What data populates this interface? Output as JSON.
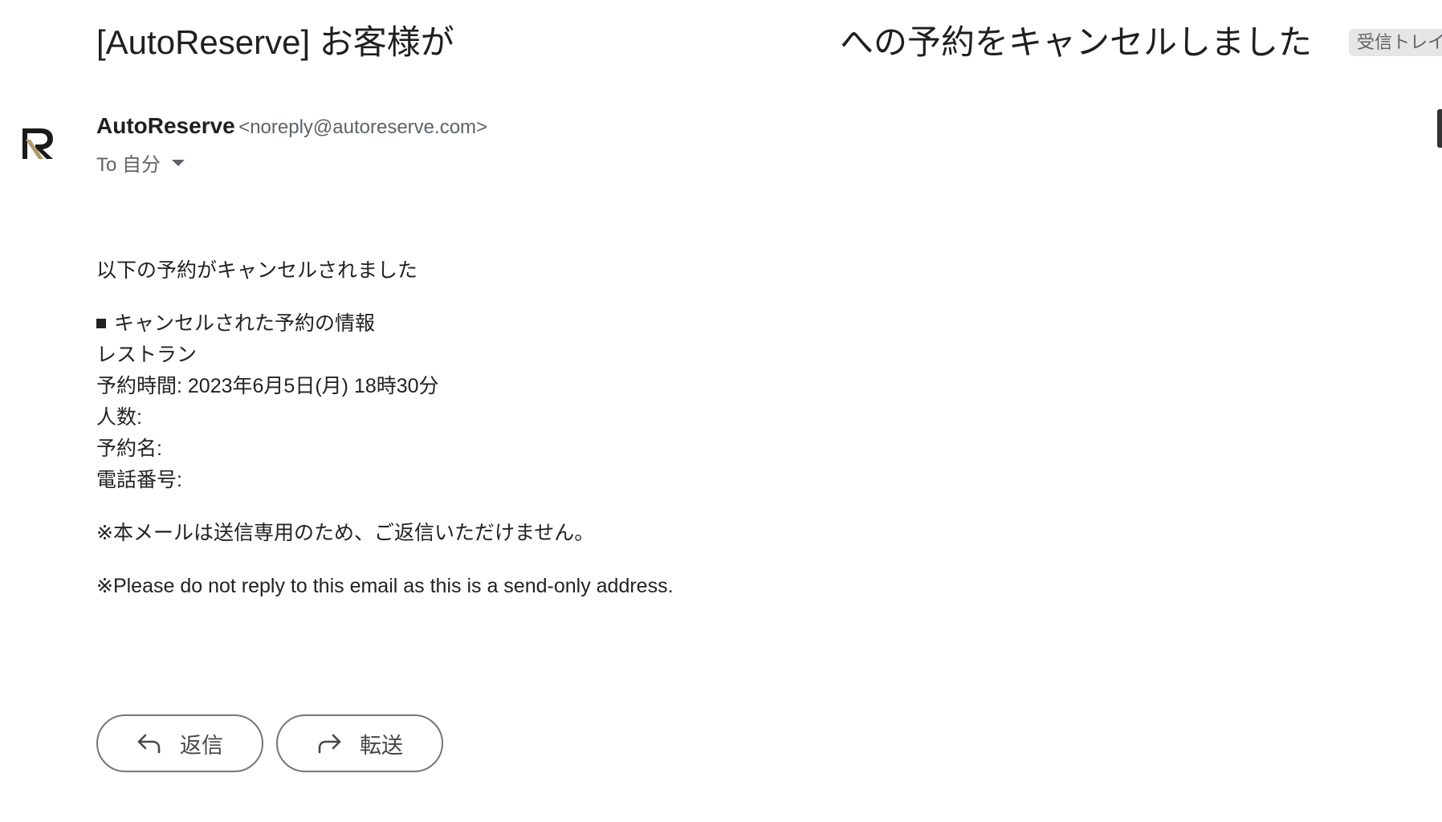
{
  "email": {
    "subject_part1": "[AutoReserve] お客様が",
    "subject_part2": "への予約をキャンセルしました",
    "label": "受信トレイ",
    "sender": {
      "name": "AutoReserve",
      "email": "<noreply@autoreserve.com>",
      "avatar_icon": "autoreserve-logo"
    },
    "to_label": "To 自分",
    "body": {
      "intro": "以下の予約がキャンセルされました",
      "section_heading": "キャンセルされた予約の情報",
      "restaurant": "レストラン",
      "reservation_time": "予約時間: 2023年6月5日(月) 18時30分",
      "party_size": "人数:",
      "reservation_name": "予約名:",
      "phone": "電話番号:",
      "notice_ja": "※本メールは送信専用のため、ご返信いただけません。",
      "notice_en": "※Please do not reply to this email as this is a send-only address."
    }
  },
  "actions": {
    "reply_label": "返信",
    "forward_label": "転送"
  },
  "colors": {
    "logo_dark": "#1a1a1a",
    "logo_gold": "#b39a6b",
    "button_border": "#747775"
  }
}
